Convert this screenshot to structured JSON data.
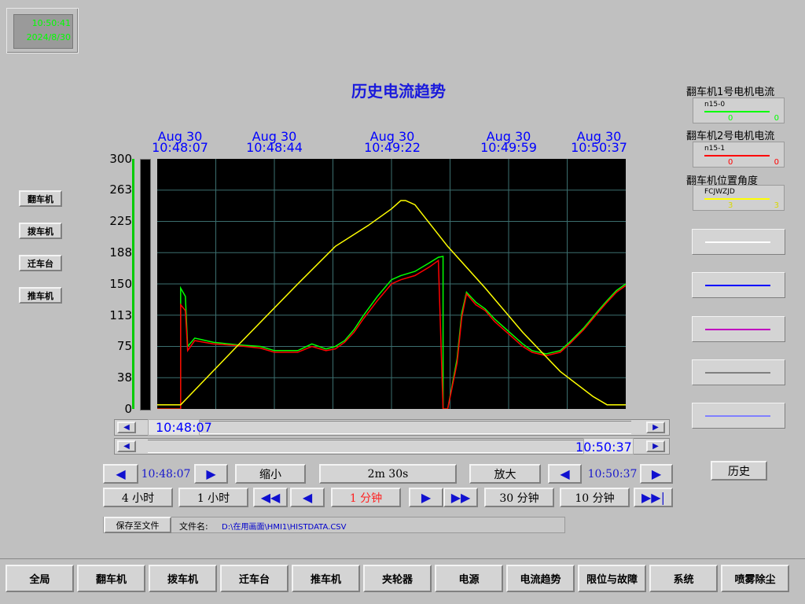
{
  "clock": {
    "time": "10:50:41",
    "date": "2024/8/30"
  },
  "title": "历史电流趋势",
  "left_buttons": [
    "翻车机",
    "拨车机",
    "迁车台",
    "推车机"
  ],
  "time_axis": [
    {
      "date": "Aug 30",
      "time": "10:48:07"
    },
    {
      "date": "Aug 30",
      "time": "10:48:44"
    },
    {
      "date": "Aug 30",
      "time": "10:49:22"
    },
    {
      "date": "Aug 30",
      "time": "10:49:59"
    },
    {
      "date": "Aug 30",
      "time": "10:50:37"
    }
  ],
  "y_ticks": [
    "300",
    "263",
    "225",
    "188",
    "150",
    "113",
    "75",
    "38",
    "0"
  ],
  "scroll": {
    "start": "10:48:07",
    "end": "10:50:37"
  },
  "controls": {
    "start_time": "10:48:07",
    "zoom_out": "缩小",
    "span": "2m 30s",
    "zoom_in": "放大",
    "end_time": "10:50:37",
    "range_4h": "4 小时",
    "range_1h": "1 小时",
    "range_1m": "1 分钟",
    "range_30m": "30 分钟",
    "range_10m": "10 分钟"
  },
  "file": {
    "save_label": "保存至文件",
    "name_label": "文件名:",
    "path": "D:\\在用画面\\HMI1\\HISTDATA.CSV"
  },
  "legend": [
    {
      "title": "翻车机1号电机电流",
      "tag": "n15-0",
      "v1": "0",
      "v2": "0",
      "color": "#00ff00"
    },
    {
      "title": "翻车机2号电机电流",
      "tag": "n15-1",
      "v1": "0",
      "v2": "0",
      "color": "#ff0000"
    },
    {
      "title": "翻车机位置角度",
      "tag": "FCJWZJD",
      "v1": "3",
      "v2": "3",
      "color": "#ffff00"
    }
  ],
  "pen_colors": [
    "#ffffff",
    "#0000ff",
    "#c000c0",
    "#808080",
    "#8080ff"
  ],
  "history_button": "历史",
  "nav": [
    "全局",
    "翻车机",
    "拨车机",
    "迁车台",
    "推车机",
    "夹轮器",
    "电源",
    "电流趋势",
    "限位与故障",
    "系统",
    "喷雾除尘"
  ],
  "chart_data": {
    "type": "line",
    "title": "历史电流趋势",
    "ylim": [
      0,
      300
    ],
    "xlim": [
      "10:48:07",
      "10:50:37"
    ],
    "grid": true,
    "series": [
      {
        "name": "翻车机1号电机电流",
        "color": "#00ff00",
        "points": [
          [
            0,
            0
          ],
          [
            0.05,
            0
          ],
          [
            0.05,
            145
          ],
          [
            0.06,
            135
          ],
          [
            0.065,
            75
          ],
          [
            0.08,
            85
          ],
          [
            0.12,
            80
          ],
          [
            0.17,
            77
          ],
          [
            0.22,
            75
          ],
          [
            0.25,
            70
          ],
          [
            0.3,
            70
          ],
          [
            0.33,
            78
          ],
          [
            0.36,
            72
          ],
          [
            0.38,
            75
          ],
          [
            0.4,
            82
          ],
          [
            0.42,
            95
          ],
          [
            0.44,
            112
          ],
          [
            0.47,
            135
          ],
          [
            0.5,
            155
          ],
          [
            0.52,
            160
          ],
          [
            0.55,
            165
          ],
          [
            0.58,
            175
          ],
          [
            0.6,
            182
          ],
          [
            0.61,
            183
          ],
          [
            0.61,
            0
          ],
          [
            0.62,
            0
          ],
          [
            0.64,
            60
          ],
          [
            0.65,
            115
          ],
          [
            0.66,
            140
          ],
          [
            0.68,
            128
          ],
          [
            0.7,
            120
          ],
          [
            0.72,
            108
          ],
          [
            0.75,
            93
          ],
          [
            0.78,
            78
          ],
          [
            0.8,
            70
          ],
          [
            0.83,
            66
          ],
          [
            0.86,
            70
          ],
          [
            0.88,
            80
          ],
          [
            0.91,
            97
          ],
          [
            0.94,
            117
          ],
          [
            0.96,
            130
          ],
          [
            0.98,
            142
          ],
          [
            1,
            150
          ]
        ],
        "range": [
          0.47,
          0.76
        ]
      },
      {
        "name": "翻车机2号电机电流",
        "color": "#ff0000",
        "points": [
          [
            0,
            0
          ],
          [
            0.05,
            0
          ],
          [
            0.05,
            125
          ],
          [
            0.06,
            118
          ],
          [
            0.065,
            70
          ],
          [
            0.08,
            82
          ],
          [
            0.12,
            78
          ],
          [
            0.17,
            76
          ],
          [
            0.22,
            73
          ],
          [
            0.25,
            68
          ],
          [
            0.3,
            68
          ],
          [
            0.33,
            75
          ],
          [
            0.36,
            70
          ],
          [
            0.38,
            72
          ],
          [
            0.4,
            80
          ],
          [
            0.42,
            92
          ],
          [
            0.44,
            108
          ],
          [
            0.47,
            130
          ],
          [
            0.5,
            150
          ],
          [
            0.52,
            155
          ],
          [
            0.55,
            160
          ],
          [
            0.58,
            170
          ],
          [
            0.6,
            178
          ],
          [
            0.61,
            0
          ],
          [
            0.62,
            0
          ],
          [
            0.64,
            55
          ],
          [
            0.65,
            110
          ],
          [
            0.66,
            138
          ],
          [
            0.68,
            125
          ],
          [
            0.7,
            118
          ],
          [
            0.72,
            105
          ],
          [
            0.75,
            90
          ],
          [
            0.78,
            75
          ],
          [
            0.8,
            68
          ],
          [
            0.83,
            64
          ],
          [
            0.86,
            68
          ],
          [
            0.88,
            78
          ],
          [
            0.91,
            95
          ],
          [
            0.94,
            115
          ],
          [
            0.96,
            128
          ],
          [
            0.98,
            140
          ],
          [
            1,
            148
          ]
        ],
        "range": [
          0.47,
          0.76
        ]
      },
      {
        "name": "翻车机位置角度",
        "color": "#ffff00",
        "points": [
          [
            0,
            5
          ],
          [
            0.05,
            5
          ],
          [
            0.17,
            75
          ],
          [
            0.3,
            150
          ],
          [
            0.38,
            195
          ],
          [
            0.45,
            220
          ],
          [
            0.5,
            240
          ],
          [
            0.52,
            250
          ],
          [
            0.53,
            250
          ],
          [
            0.55,
            245
          ],
          [
            0.62,
            195
          ],
          [
            0.7,
            145
          ],
          [
            0.78,
            92
          ],
          [
            0.86,
            45
          ],
          [
            0.93,
            15
          ],
          [
            0.96,
            5
          ],
          [
            1,
            5
          ]
        ],
        "range": [
          0,
          1
        ]
      }
    ]
  }
}
